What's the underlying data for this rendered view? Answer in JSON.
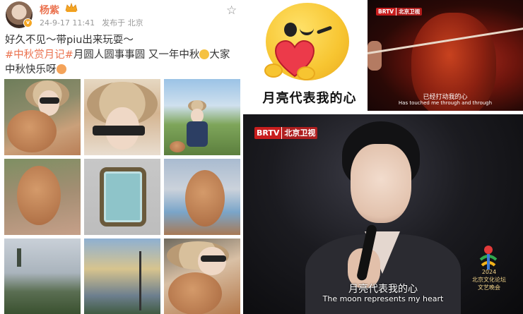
{
  "post": {
    "username": "杨紫",
    "date": "24-9-17 11:41",
    "location": "发布于 北京",
    "text_line1": "好久不见～带piu出来玩耍～",
    "topic": "#中秋赏月记#",
    "text_line2_rest": "月圆人圆事事圆 又一年中秋",
    "text_line2_tail": "大家",
    "text_line3": "中秋快乐呀",
    "photos": [
      "photo-1",
      "photo-2",
      "photo-3",
      "photo-4",
      "photo-5",
      "photo-6",
      "photo-7",
      "photo-8",
      "photo-9"
    ]
  },
  "sticker": {
    "caption": "月亮代表我的心"
  },
  "violin_clip": {
    "logo_channel": "BRTV",
    "logo_name": "北京卫视",
    "subtitle_cn": "已经打动我的心",
    "subtitle_en": "Has touched me through and through"
  },
  "stage_clip": {
    "logo_channel": "BRTV",
    "logo_name": "北京卫视",
    "festival_year": "2024",
    "festival_line1": "北京文化论坛",
    "festival_line2": "文艺晚会",
    "subtitle_cn": "月亮代表我的心",
    "subtitle_en": "The moon represents my heart"
  },
  "colors": {
    "accent": "#eb7350",
    "brtv_red": "#c81e1e",
    "meta_gray": "#999999"
  },
  "icons": [
    "vip-crown-icon",
    "verified-badge-icon",
    "favorite-star-icon",
    "moon-emoji-icon",
    "love-emoji-icon"
  ]
}
